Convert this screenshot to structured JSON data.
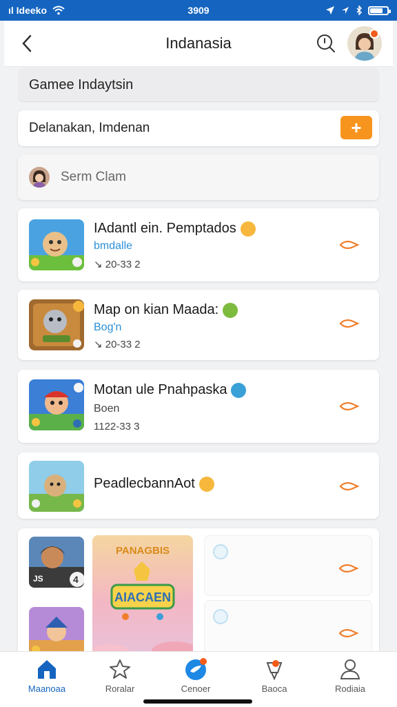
{
  "status_bar": {
    "carrier": "ıl Ideeko",
    "time": "3909"
  },
  "header": {
    "title": "Indanasia"
  },
  "games_bar": {
    "label": "Gamee Indaytsin"
  },
  "add_row": {
    "label": "Delanakan, Imdenan",
    "add_label": "+"
  },
  "search": {
    "placeholder": "Serm Clam"
  },
  "items": [
    {
      "name": "IAdantl ein. Pemptados",
      "sub": "bmdalle",
      "meta": "↘ 20-33 2"
    },
    {
      "name": "Map on kian Maada:",
      "sub": "Bog'n",
      "meta": "↘ 20-33 2"
    },
    {
      "name": "Motan ule Pnahpaska",
      "sub": "Boen",
      "meta": "1122-33 3"
    },
    {
      "name": "PeadlecbannAot",
      "sub": "",
      "meta": ""
    }
  ],
  "grid": {
    "thumb_badge": "4",
    "thumb_label": "JS",
    "feature_top": "PANAGBIS",
    "feature_main": "AIACAEN"
  },
  "tabs": [
    {
      "label": "Maanoaa"
    },
    {
      "label": "Roralar"
    },
    {
      "label": "Cenoer"
    },
    {
      "label": "Baoca"
    },
    {
      "label": "Rodiaia"
    }
  ],
  "colors": {
    "brand_blue": "#1565c0",
    "accent_orange": "#f7941d",
    "link_blue": "#2a8fd8"
  },
  "icons": {
    "back": "chevron-left-icon",
    "search": "search-icon",
    "add": "plus-icon",
    "go": "arrow-right-icon",
    "home": "home-icon",
    "star": "star-icon",
    "center": "bird-icon",
    "badge": "badge-icon",
    "person": "person-icon"
  }
}
